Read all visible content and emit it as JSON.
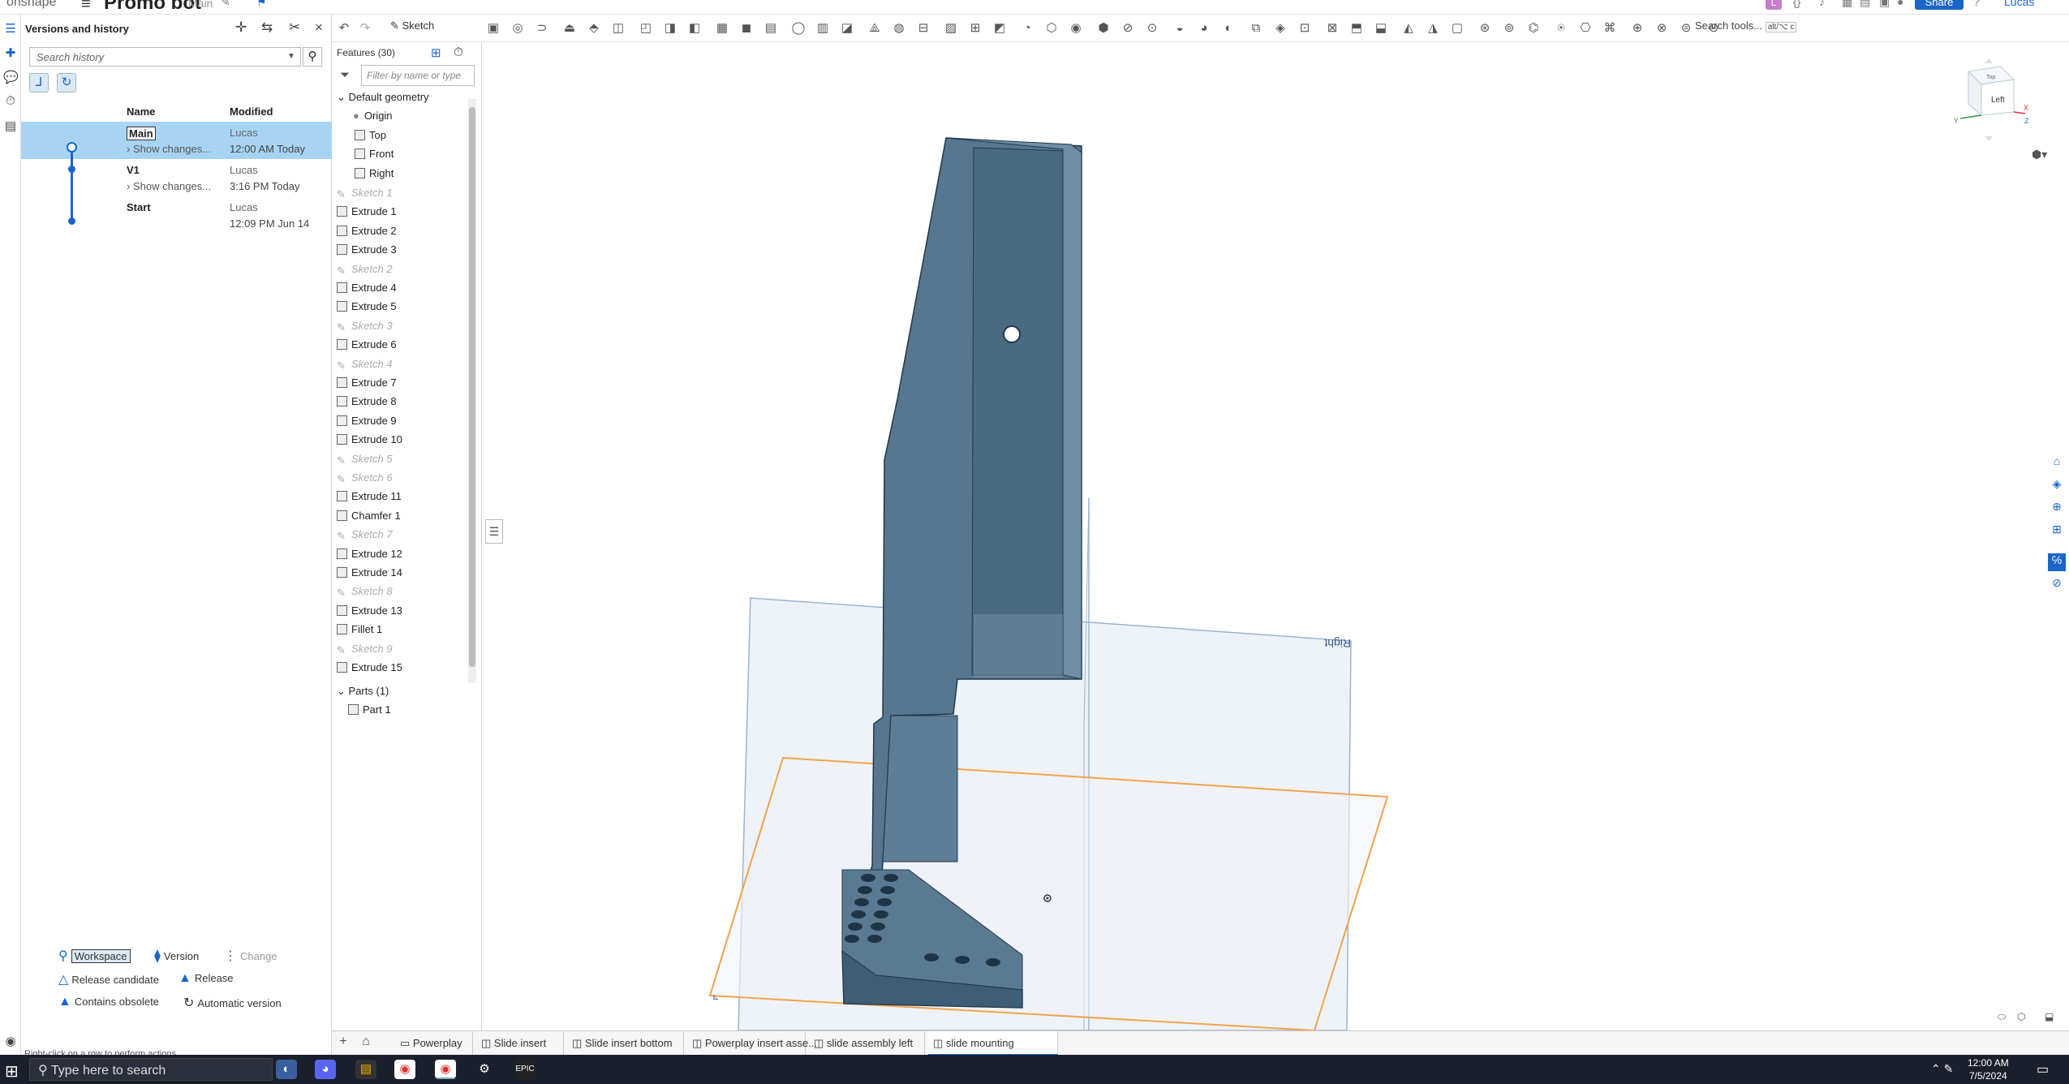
{
  "app": {
    "logo": "onshape",
    "document_title": "Promo bot",
    "workspace_label": "Main",
    "share_label": "Share",
    "user_label": "Lucas",
    "avatar_letter": "L"
  },
  "history_panel": {
    "title": "Versions and history",
    "search_placeholder": "Search history",
    "col_name": "Name",
    "col_modified": "Modified",
    "rows": [
      {
        "name": "Main",
        "changes": "Show changes...",
        "author": "Lucas",
        "time": "12:00 AM Today"
      },
      {
        "name": "V1",
        "changes": "Show changes...",
        "author": "Lucas",
        "time": "3:16 PM Today"
      },
      {
        "name": "Start",
        "changes": "",
        "author": "Lucas",
        "time": "12:09 PM Jun 14"
      }
    ],
    "legend": {
      "workspace": "Workspace",
      "version": "Version",
      "change": "Change",
      "release_candidate": "Release candidate",
      "release": "Release",
      "contains_obsolete": "Contains obsolete",
      "automatic_version": "Automatic version"
    },
    "status_hint": "Right-click on a row to perform actions"
  },
  "toolbar": {
    "sketch_label": "Sketch",
    "search_tools_label": "Search tools...",
    "search_tools_shortcut": "alt/⌥ c"
  },
  "features": {
    "header": "Features (30)",
    "filter_placeholder": "Filter by name or type",
    "default_geometry": "Default geometry",
    "geometry_items": [
      "Origin",
      "Top",
      "Front",
      "Right"
    ],
    "items": [
      {
        "label": "Sketch 1",
        "kind": "sketch"
      },
      {
        "label": "Extrude 1",
        "kind": "feature"
      },
      {
        "label": "Extrude 2",
        "kind": "feature"
      },
      {
        "label": "Extrude 3",
        "kind": "feature"
      },
      {
        "label": "Sketch 2",
        "kind": "sketch"
      },
      {
        "label": "Extrude 4",
        "kind": "feature"
      },
      {
        "label": "Extrude 5",
        "kind": "feature"
      },
      {
        "label": "Sketch 3",
        "kind": "sketch"
      },
      {
        "label": "Extrude 6",
        "kind": "feature"
      },
      {
        "label": "Sketch 4",
        "kind": "sketch"
      },
      {
        "label": "Extrude 7",
        "kind": "feature"
      },
      {
        "label": "Extrude 8",
        "kind": "feature"
      },
      {
        "label": "Extrude 9",
        "kind": "feature"
      },
      {
        "label": "Extrude 10",
        "kind": "feature"
      },
      {
        "label": "Sketch 5",
        "kind": "sketch"
      },
      {
        "label": "Sketch 6",
        "kind": "sketch"
      },
      {
        "label": "Extrude 11",
        "kind": "feature"
      },
      {
        "label": "Chamfer 1",
        "kind": "feature"
      },
      {
        "label": "Sketch 7",
        "kind": "sketch"
      },
      {
        "label": "Extrude 12",
        "kind": "feature"
      },
      {
        "label": "Extrude 14",
        "kind": "feature"
      },
      {
        "label": "Sketch 8",
        "kind": "sketch"
      },
      {
        "label": "Extrude 13",
        "kind": "feature"
      },
      {
        "label": "Fillet 1",
        "kind": "feature"
      },
      {
        "label": "Sketch 9",
        "kind": "sketch"
      },
      {
        "label": "Extrude 15",
        "kind": "feature"
      }
    ],
    "parts_header": "Parts (1)",
    "parts": [
      "Part 1"
    ]
  },
  "viewport": {
    "plane_label": "Right",
    "view_cube_label": "Left",
    "cube_top_label": "Top",
    "axis_x": "X",
    "axis_y": "Y",
    "axis_z": "Z"
  },
  "tabs": [
    {
      "label": "Powerplay",
      "active": false
    },
    {
      "label": "Slide insert",
      "active": false
    },
    {
      "label": "Slide insert bottom",
      "active": false
    },
    {
      "label": "Powerplay insert asse...",
      "active": false
    },
    {
      "label": "slide assembly left",
      "active": false
    },
    {
      "label": "slide mounting",
      "active": true
    }
  ],
  "taskbar": {
    "search_placeholder": "Type here to search",
    "time": "12:00 AM",
    "date": "7/5/2024"
  },
  "colors": {
    "accent": "#1b65c9",
    "selected_row": "#a8d4f3",
    "part_fill": "#4e6e87",
    "plane": "#9bb4d0",
    "plane_selected": "#f2a24a"
  }
}
